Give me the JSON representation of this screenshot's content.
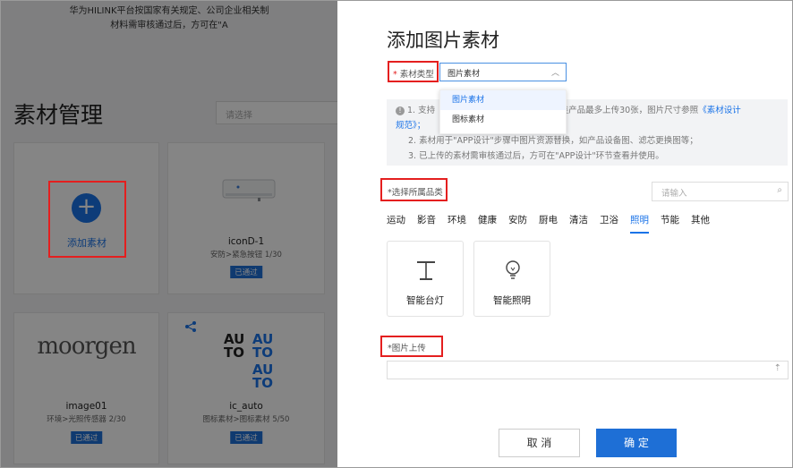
{
  "background": {
    "notice_lines": [
      "华为HILINK平台按国家有关规定、公司企业相关制",
      "材料需审核通过后，方可在\"A"
    ],
    "page_title": "素材管理",
    "filter_placeholder": "请选择",
    "add_card_label": "添加素材",
    "cards": [
      {
        "name": "iconD-1",
        "sub": "安防>紧急按钮 1/30",
        "badge": "已通过",
        "image": "water-heater-image"
      },
      {
        "name": "image01",
        "sub": "环境>光照传感器 2/30",
        "badge": "已通过",
        "image": "moorgen-logo"
      },
      {
        "name": "ic_auto",
        "sub": "图标素材>图标素材 5/50",
        "badge": "已通过",
        "image": "auto-logo"
      }
    ],
    "moorgen_text": "moorgen",
    "auto_text": "AU\nTO"
  },
  "drawer": {
    "title": "添加图片素材",
    "type_field": {
      "required_mark": "*",
      "label": "素材类型",
      "value": "图片素材"
    },
    "type_options": [
      "图片素材",
      "图标素材"
    ],
    "notes": {
      "line1_pre": "1. 支持",
      "line1_post": "每类产品最多上传30张，图片尺寸参照",
      "line1_link": "《素材设计",
      "line2_link": "规范》；",
      "line3": "2. 素材用于\"APP设计\"步骤中图片资源替换，如产品设备图、滤芯更换图等；",
      "line4": "3. 已上传的素材需审核通过后，方可在\"APP设计\"环节查看并使用。"
    },
    "category_label": "*选择所属品类",
    "search_placeholder": "请输入",
    "tabs": [
      "运动",
      "影音",
      "环境",
      "健康",
      "安防",
      "厨电",
      "清洁",
      "卫浴",
      "照明",
      "节能",
      "其他"
    ],
    "active_tab": "照明",
    "products": [
      {
        "name": "智能台灯",
        "icon": "desk-lamp-icon"
      },
      {
        "name": "智能照明",
        "icon": "light-bulb-icon"
      }
    ],
    "upload_label": "*图片上传",
    "cancel_label": "取 消",
    "confirm_label": "确 定"
  },
  "colors": {
    "accent": "#1a73e8",
    "highlight_box": "#e41f1f",
    "badge": "#1e6fd6"
  }
}
